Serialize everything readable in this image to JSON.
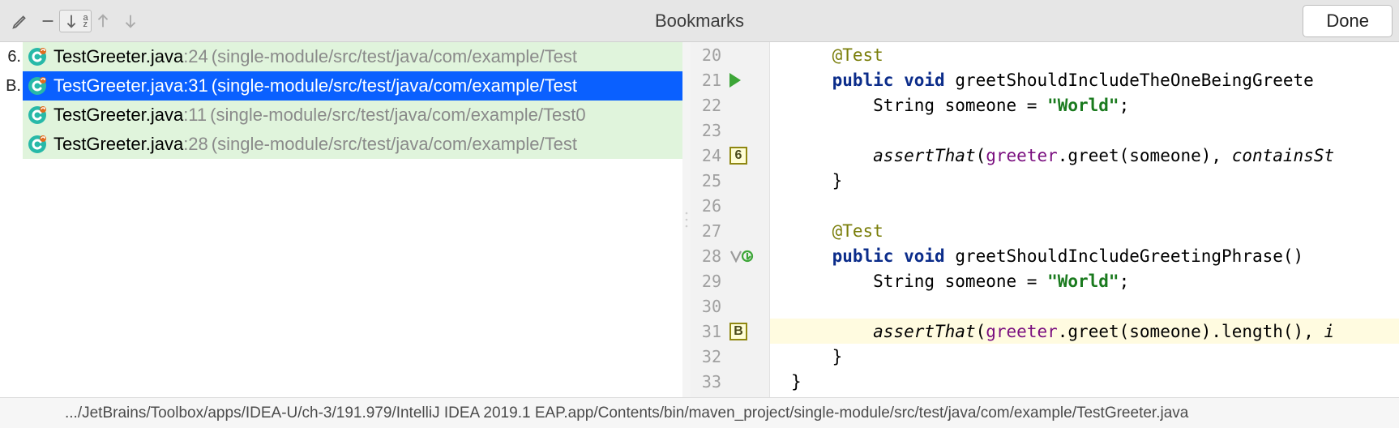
{
  "toolbar": {
    "title": "Bookmarks",
    "done": "Done"
  },
  "bookmarks": [
    {
      "mnemonic": "6.",
      "file": "TestGreeter.java",
      "line": ":24",
      "path": " (single-module/src/test/java/com/example/Test",
      "selected": false
    },
    {
      "mnemonic": "B.",
      "file": "TestGreeter.java",
      "line": ":31",
      "path": " (single-module/src/test/java/com/example/Test",
      "selected": true
    },
    {
      "mnemonic": "",
      "file": "TestGreeter.java",
      "line": ":11",
      "path": " (single-module/src/test/java/com/example/Test0",
      "selected": false
    },
    {
      "mnemonic": "",
      "file": "TestGreeter.java",
      "line": ":28",
      "path": " (single-module/src/test/java/com/example/Test",
      "selected": false
    }
  ],
  "editor": {
    "lines": [
      {
        "n": "20",
        "icon": "",
        "code": [
          {
            "t": "    ",
            "c": ""
          },
          {
            "t": "@Test",
            "c": "an"
          }
        ]
      },
      {
        "n": "21",
        "icon": "run",
        "code": [
          {
            "t": "    ",
            "c": ""
          },
          {
            "t": "public",
            "c": "k"
          },
          {
            "t": " ",
            "c": ""
          },
          {
            "t": "void",
            "c": "k"
          },
          {
            "t": " greetShouldIncludeTheOneBeingGreete",
            "c": ""
          }
        ]
      },
      {
        "n": "22",
        "icon": "",
        "code": [
          {
            "t": "        String someone = ",
            "c": ""
          },
          {
            "t": "\"World\"",
            "c": "s"
          },
          {
            "t": ";",
            "c": ""
          }
        ]
      },
      {
        "n": "23",
        "icon": "",
        "code": [
          {
            "t": "",
            "c": ""
          }
        ]
      },
      {
        "n": "24",
        "icon": "mn6",
        "code": [
          {
            "t": "        ",
            "c": ""
          },
          {
            "t": "assertThat",
            "c": "it"
          },
          {
            "t": "(",
            "c": ""
          },
          {
            "t": "greeter",
            "c": "m"
          },
          {
            "t": ".greet(someone), ",
            "c": ""
          },
          {
            "t": "containsSt",
            "c": "it"
          }
        ]
      },
      {
        "n": "25",
        "icon": "",
        "code": [
          {
            "t": "    }",
            "c": ""
          }
        ]
      },
      {
        "n": "26",
        "icon": "",
        "code": [
          {
            "t": "",
            "c": ""
          }
        ]
      },
      {
        "n": "27",
        "icon": "",
        "code": [
          {
            "t": "    ",
            "c": ""
          },
          {
            "t": "@Test",
            "c": "an"
          }
        ]
      },
      {
        "n": "28",
        "icon": "ovr",
        "code": [
          {
            "t": "    ",
            "c": ""
          },
          {
            "t": "public",
            "c": "k"
          },
          {
            "t": " ",
            "c": ""
          },
          {
            "t": "void",
            "c": "k"
          },
          {
            "t": " greetShouldIncludeGreetingPhrase()",
            "c": ""
          }
        ]
      },
      {
        "n": "29",
        "icon": "",
        "code": [
          {
            "t": "        String someone = ",
            "c": ""
          },
          {
            "t": "\"World\"",
            "c": "s"
          },
          {
            "t": ";",
            "c": ""
          }
        ]
      },
      {
        "n": "30",
        "icon": "",
        "code": [
          {
            "t": "",
            "c": ""
          }
        ]
      },
      {
        "n": "31",
        "icon": "mnB",
        "hl": true,
        "code": [
          {
            "t": "        ",
            "c": ""
          },
          {
            "t": "assertThat",
            "c": "it"
          },
          {
            "t": "(",
            "c": ""
          },
          {
            "t": "greeter",
            "c": "m"
          },
          {
            "t": ".greet(someone).length(), ",
            "c": ""
          },
          {
            "t": "i",
            "c": "it"
          }
        ]
      },
      {
        "n": "32",
        "icon": "",
        "code": [
          {
            "t": "    }",
            "c": ""
          }
        ]
      },
      {
        "n": "33",
        "icon": "",
        "code": [
          {
            "t": "}",
            "c": ""
          }
        ]
      }
    ],
    "mnemonics": {
      "mn6": "6",
      "mnB": "B"
    }
  },
  "status": ".../JetBrains/Toolbox/apps/IDEA-U/ch-3/191.979/IntelliJ IDEA 2019.1 EAP.app/Contents/bin/maven_project/single-module/src/test/java/com/example/TestGreeter.java"
}
